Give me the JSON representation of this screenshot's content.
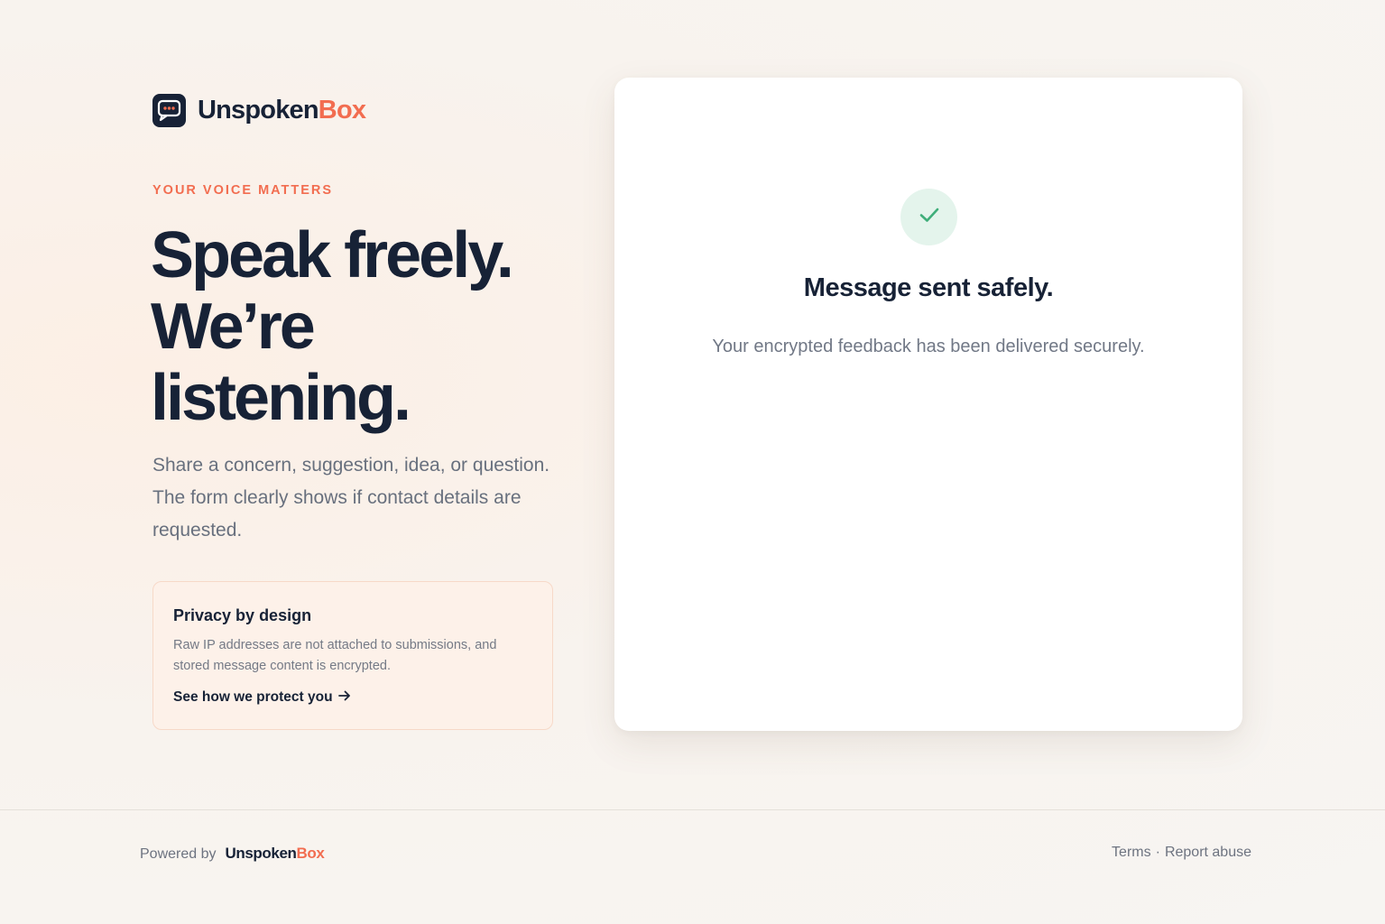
{
  "brand": {
    "name_main": "Unspoken",
    "name_accent": "Box",
    "icon": "chat-bubble-icon"
  },
  "hero": {
    "eyebrow": "YOUR VOICE MATTERS",
    "headline_lines": [
      "Speak freely.",
      "We’re",
      "listening."
    ],
    "lede": "Share a concern, suggestion, idea, or question. The form clearly shows if contact details are requested."
  },
  "privacy": {
    "title": "Privacy by design",
    "body": "Raw IP addresses are not attached to submissions, and stored message content is encrypted.",
    "link_label": "See how we protect you",
    "link_icon": "arrow-right-icon"
  },
  "confirmation": {
    "icon": "check-icon",
    "title": "Message sent safely.",
    "body": "Your encrypted feedback has been delivered securely."
  },
  "footer": {
    "powered_by": "Powered by",
    "brand_main": "Unspoken",
    "brand_accent": "Box",
    "terms_label": "Terms",
    "separator": "·",
    "report_label": "Report abuse"
  },
  "colors": {
    "accent": "#f26d50",
    "navy": "#172236",
    "success": "#3fae7a",
    "success_bg": "#e4f4ec"
  }
}
